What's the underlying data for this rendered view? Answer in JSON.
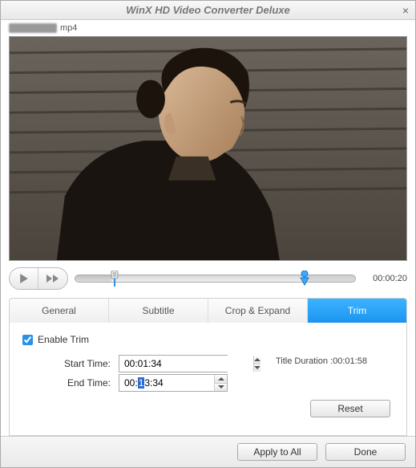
{
  "window": {
    "title": "WinX HD Video Converter Deluxe"
  },
  "file": {
    "ext": "mp4"
  },
  "playback": {
    "current_time": "00:00:20"
  },
  "tabs": {
    "general": "General",
    "subtitle": "Subtitle",
    "crop": "Crop & Expand",
    "trim": "Trim",
    "active": "trim"
  },
  "trim": {
    "enable_label": "Enable Trim",
    "enabled": true,
    "start_label": "Start Time:",
    "start_value": "00:01:34",
    "end_label": "End Time:",
    "end_prefix": "00:",
    "end_sel": "1",
    "end_suffix": "3:34",
    "duration_label": "Title Duration :",
    "duration_value": "00:01:58",
    "reset_label": "Reset"
  },
  "footer": {
    "apply_all": "Apply to All",
    "done": "Done"
  }
}
